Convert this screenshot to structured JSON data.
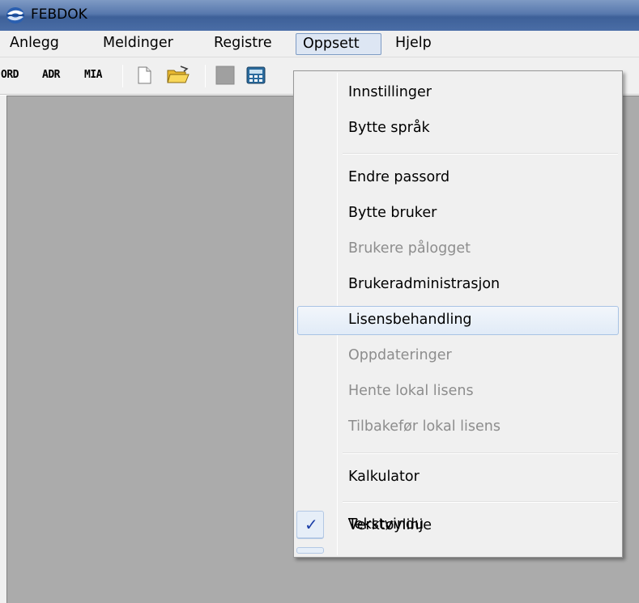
{
  "window": {
    "title": "FEBDOK",
    "icon": "febdok-app-icon"
  },
  "menubar": {
    "items": [
      {
        "label": "Anlegg"
      },
      {
        "label": "Meldinger"
      },
      {
        "label": "Registre"
      },
      {
        "label": "Oppsett"
      },
      {
        "label": "Hjelp"
      }
    ]
  },
  "toolbar": {
    "text_buttons": [
      "ORD",
      "ADR",
      "MIA"
    ],
    "icons": [
      "new-document-icon",
      "open-folder-icon",
      "gray-square-icon",
      "calculator-icon"
    ]
  },
  "dropdown": {
    "items": [
      {
        "label": "Innstillinger",
        "enabled": true
      },
      {
        "label": "Bytte språk",
        "enabled": true
      },
      {
        "label": "Endre passord",
        "enabled": true
      },
      {
        "label": "Bytte bruker",
        "enabled": true
      },
      {
        "label": "Brukere pålogget",
        "enabled": false
      },
      {
        "label": "Brukeradministrasjon",
        "enabled": true
      },
      {
        "label": "Lisensbehandling",
        "enabled": true,
        "highlighted": true
      },
      {
        "label": "Oppdateringer",
        "enabled": false
      },
      {
        "label": "Hente lokal lisens",
        "enabled": false
      },
      {
        "label": "Tilbakefør lokal lisens",
        "enabled": false
      },
      {
        "label": "Kalkulator",
        "enabled": true
      },
      {
        "label": "Verktøylinje",
        "enabled": true,
        "checked": true
      },
      {
        "label": "Tekstvindu",
        "enabled": true,
        "checked": true
      }
    ],
    "check_glyph": "✓"
  },
  "colors": {
    "titlebar": "#4a6da6",
    "menubar": "#f0f0f0",
    "client_area": "#ababab",
    "highlight_border": "#a8c3e4",
    "disabled_text": "#8d8d8d",
    "check_color": "#1c3fa8"
  }
}
